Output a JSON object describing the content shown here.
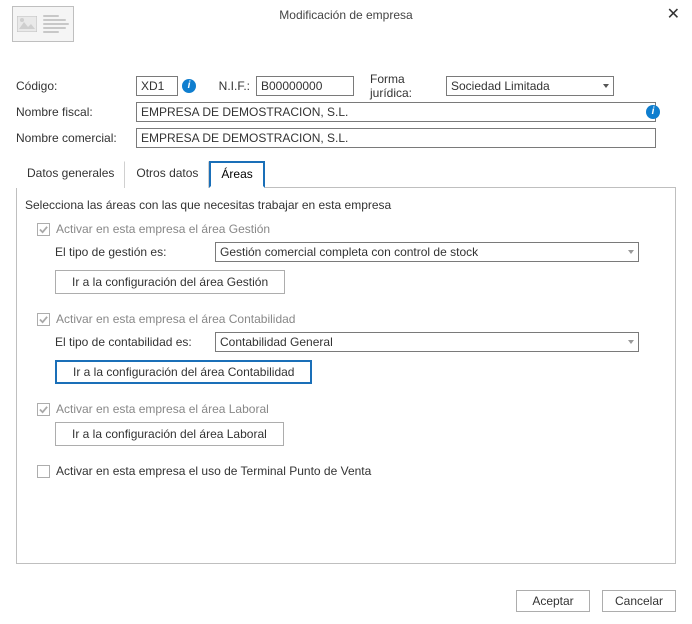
{
  "window": {
    "title": "Modificación de empresa"
  },
  "fields": {
    "codigo_label": "Código:",
    "codigo_value": "XD1",
    "nif_label": "N.I.F.:",
    "nif_value": "B00000000",
    "forma_label": "Forma jurídica:",
    "forma_value": "Sociedad Limitada",
    "nombre_fiscal_label": "Nombre fiscal:",
    "nombre_fiscal_value": "EMPRESA DE DEMOSTRACION, S.L.",
    "nombre_comercial_label": "Nombre comercial:",
    "nombre_comercial_value": "EMPRESA DE DEMOSTRACION, S.L."
  },
  "tabs": {
    "t0": "Datos generales",
    "t1": "Otros datos",
    "t2": "Áreas"
  },
  "areas": {
    "intro": "Selecciona las áreas con las que necesitas trabajar en esta empresa",
    "gestion": {
      "chk_label": "Activar en esta empresa el área Gestión",
      "tipo_label": "El tipo de gestión es:",
      "tipo_value": "Gestión comercial completa con control de stock",
      "btn": "Ir a la configuración del área Gestión"
    },
    "contabilidad": {
      "chk_label": "Activar en esta empresa el área Contabilidad",
      "tipo_label": "El tipo de contabilidad es:",
      "tipo_value": "Contabilidad General",
      "btn": "Ir a la configuración del área Contabilidad"
    },
    "laboral": {
      "chk_label": "Activar en esta empresa el área Laboral",
      "btn": "Ir a la configuración del área Laboral"
    },
    "tpv": {
      "chk_label": "Activar en esta empresa el uso de Terminal Punto de Venta"
    }
  },
  "footer": {
    "accept": "Aceptar",
    "cancel": "Cancelar"
  }
}
